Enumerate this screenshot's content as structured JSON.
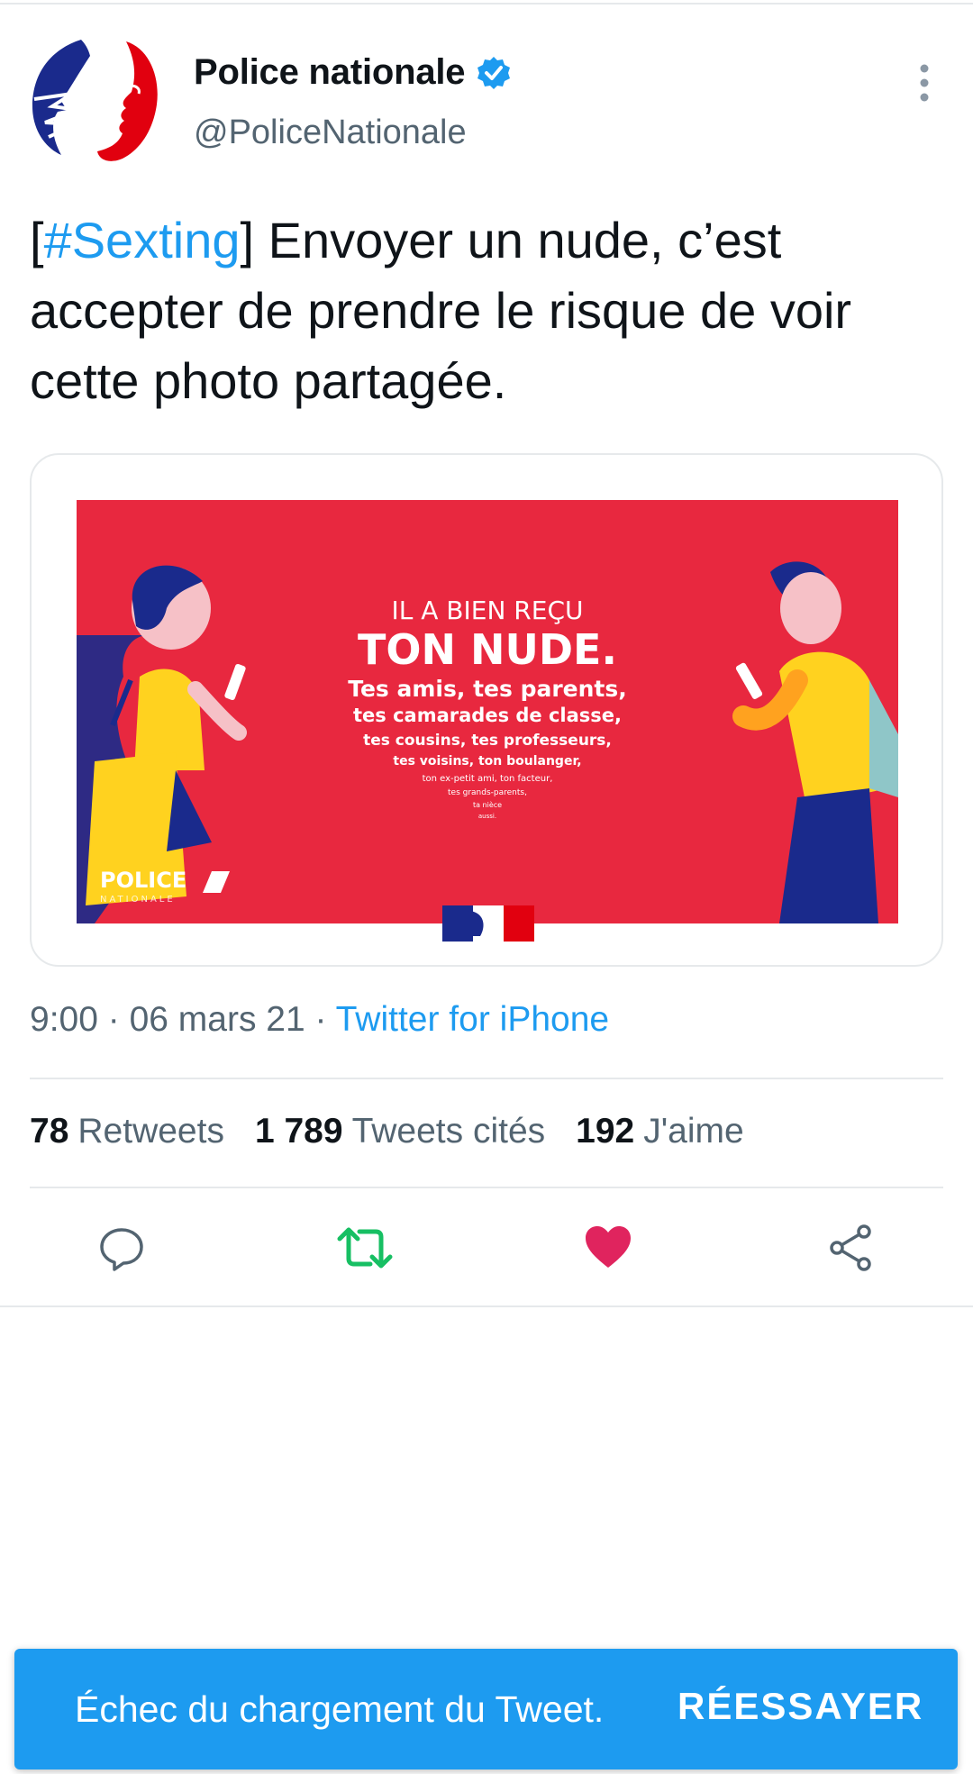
{
  "author": {
    "display_name": "Police nationale",
    "handle": "@PoliceNationale",
    "verified": true
  },
  "tweet": {
    "text_bracket_open": "[",
    "hashtag": "#Sexting",
    "text_rest": "] Envoyer un nude, c’est accepter de prendre le risque de voir cette photo partagée."
  },
  "media": {
    "line1": "IL A BIEN REÇU",
    "line2": "TON NUDE.",
    "line3": "Tes amis, tes parents,",
    "line4": "tes camarades de classe,",
    "line5": "tes cousins, tes professeurs,",
    "line6": "tes voisins, ton boulanger,",
    "line7": "ton ex-petit ami, ton facteur,",
    "line8": "tes grands-parents,",
    "line9": "ta nièce",
    "line10": "aussi.",
    "logo_text": "POLICE",
    "logo_subtext": "NATIONALE",
    "bg_color": "#e8283f"
  },
  "meta": {
    "time_date": "9:00 · 06 mars 21 · ",
    "source": "Twitter for iPhone"
  },
  "stats": {
    "retweets_count": "78",
    "retweets_label": "Retweets",
    "quotes_count": "1 789",
    "quotes_label": "Tweets cités",
    "likes_count": "192",
    "likes_label": "J'aime"
  },
  "actions": [
    {
      "name": "reply-icon"
    },
    {
      "name": "retweet-icon",
      "color": "#17bf63"
    },
    {
      "name": "heart-icon",
      "color": "#e0245e"
    },
    {
      "name": "share-icon"
    }
  ],
  "snackbar": {
    "message": "Échec du chargement du Tweet.",
    "button": "RÉESSAYER",
    "bg_color": "#1d9bf0"
  }
}
